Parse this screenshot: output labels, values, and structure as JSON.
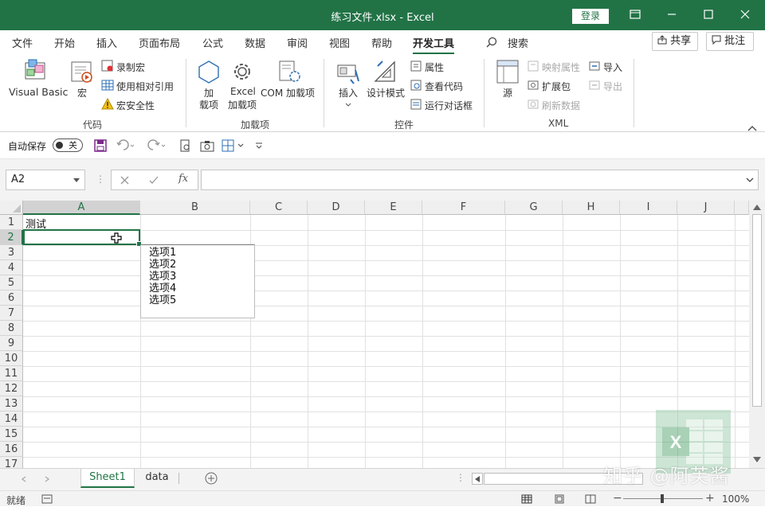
{
  "window": {
    "title": "练习文件.xlsx  -  Excel",
    "login_label": "登录",
    "brand_color": "#217346"
  },
  "tabs": [
    {
      "label": "文件"
    },
    {
      "label": "开始"
    },
    {
      "label": "插入"
    },
    {
      "label": "页面布局"
    },
    {
      "label": "公式"
    },
    {
      "label": "数据"
    },
    {
      "label": "审阅"
    },
    {
      "label": "视图"
    },
    {
      "label": "帮助"
    },
    {
      "label": "开发工具"
    },
    {
      "label": "搜索"
    }
  ],
  "active_tab": "开发工具",
  "share_label": "共享",
  "comment_label": "批注",
  "ribbon": {
    "code": {
      "name": "代码",
      "visual_basic": "Visual Basic",
      "macros": "宏",
      "record_macro": "录制宏",
      "relative_ref": "使用相对引用",
      "macro_security": "宏安全性"
    },
    "addins": {
      "name": "加载项",
      "addins": "加\n载项",
      "addins_line1": "加",
      "addins_line2": "载项",
      "excel_addins_line1": "Excel",
      "excel_addins_line2": "加载项",
      "com_addins": "COM 加载项"
    },
    "controls": {
      "name": "控件",
      "insert": "插入",
      "design_mode": "设计模式",
      "properties": "属性",
      "view_code": "查看代码",
      "run_dialog": "运行对话框"
    },
    "xml": {
      "name": "XML",
      "source": "源",
      "map_props": "映射属性",
      "expansion": "扩展包",
      "refresh": "刷新数据",
      "import": "导入",
      "export": "导出"
    }
  },
  "qat": {
    "autosave_label": "自动保存",
    "autosave_state": "关"
  },
  "formula_bar": {
    "name_box": "A2",
    "fx": "fx",
    "formula": ""
  },
  "columns": [
    "A",
    "B",
    "C",
    "D",
    "E",
    "F",
    "G",
    "H",
    "I",
    "J"
  ],
  "rows": [
    "1",
    "2",
    "3",
    "4",
    "5",
    "6",
    "7",
    "8",
    "9",
    "10",
    "11",
    "12",
    "13",
    "14",
    "15",
    "16",
    "17"
  ],
  "cells": {
    "A1": "测试"
  },
  "listbox_options": [
    "选项1",
    "选项2",
    "选项3",
    "选项4",
    "选项5"
  ],
  "sheets": [
    {
      "name": "Sheet1",
      "active": true
    },
    {
      "name": "data",
      "active": false
    }
  ],
  "status": {
    "ready": "就绪",
    "zoom": "100%"
  },
  "watermark": "知乎 @阿芙酱"
}
